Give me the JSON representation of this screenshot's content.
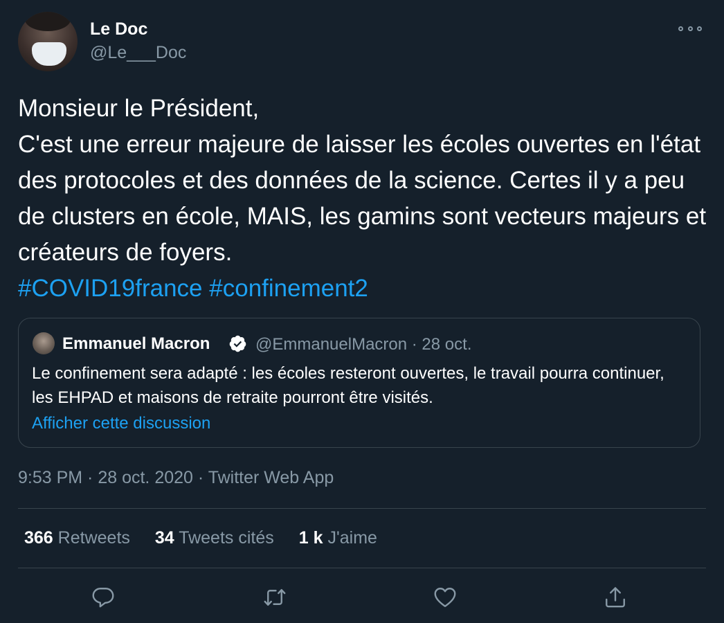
{
  "author": {
    "name": "Le Doc",
    "handle": "@Le___Doc"
  },
  "tweet": {
    "text": "Monsieur le Président,\nC'est une erreur majeure de laisser les écoles ouvertes en l'état des protocoles et des données de la science. Certes il y a peu de clusters en école, MAIS, les gamins sont vecteurs majeurs et créateurs de foyers.",
    "hashtags": [
      "#COVID19france",
      "#confinement2"
    ]
  },
  "quoted_tweet": {
    "name": "Emmanuel Macron",
    "handle_date": "@EmmanuelMacron · 28 oct.",
    "text": "Le confinement sera adapté : les écoles resteront ouvertes, le travail pourra continuer, les EHPAD et maisons de retraite pourront être visités.",
    "link": "Afficher cette discussion"
  },
  "meta": "9:53 PM · 28 oct. 2020 · Twitter Web App",
  "stats": {
    "retweets_count": "366",
    "retweets_label": "Retweets",
    "quotes_count": "34",
    "quotes_label": "Tweets cités",
    "likes_count": "1 k",
    "likes_label": "J'aime"
  },
  "icons": {
    "more": "more-icon",
    "verified": "verified-icon",
    "reply": "reply-icon",
    "retweet": "retweet-icon",
    "like": "like-icon",
    "share": "share-icon"
  },
  "colors": {
    "background": "#15202b",
    "text": "#ffffff",
    "secondary": "#8899a6",
    "link": "#1da1f2",
    "border": "#38444d"
  }
}
